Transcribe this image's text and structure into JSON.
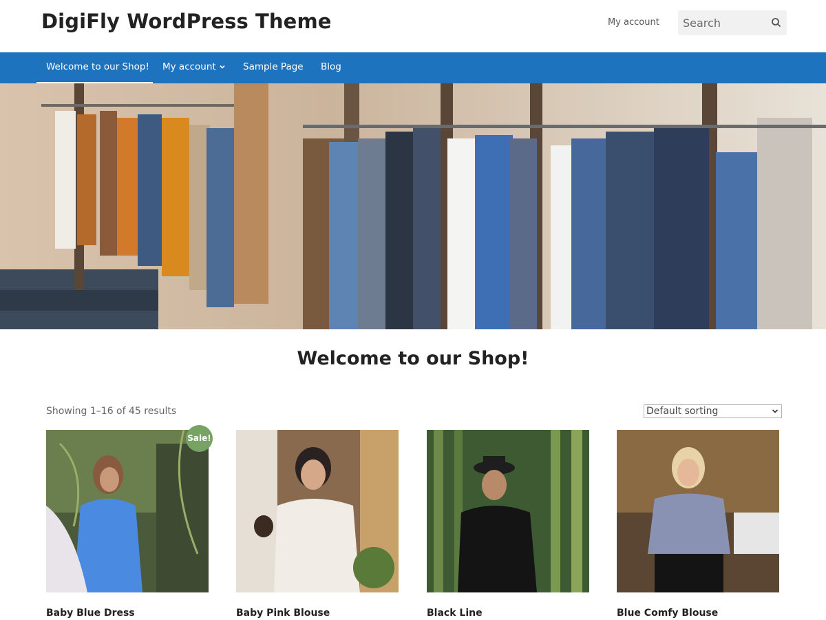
{
  "header": {
    "site_title": "DigiFly WordPress Theme",
    "account_link": "My account",
    "search_placeholder": "Search"
  },
  "nav": {
    "items": [
      {
        "label": "Welcome to our Shop!",
        "active": true
      },
      {
        "label": "My account",
        "has_dropdown": true
      },
      {
        "label": "Sample Page"
      },
      {
        "label": "Blog"
      }
    ]
  },
  "shop": {
    "title": "Welcome to our Shop!",
    "result_count": "Showing 1–16 of 45 results",
    "sorting": "Default sorting"
  },
  "products": [
    {
      "name": "Baby Blue Dress",
      "sale_badge": "Sale!"
    },
    {
      "name": "Baby Pink Blouse"
    },
    {
      "name": "Black Line"
    },
    {
      "name": "Blue Comfy Blouse"
    }
  ],
  "colors": {
    "nav_bg": "#1e73be",
    "sale_badge": "#77a464",
    "title_text": "#222222"
  },
  "icons": {
    "search": "search-icon",
    "nav_dropdown": "chevron-down-icon",
    "sort_dropdown": "chevron-down-icon"
  }
}
